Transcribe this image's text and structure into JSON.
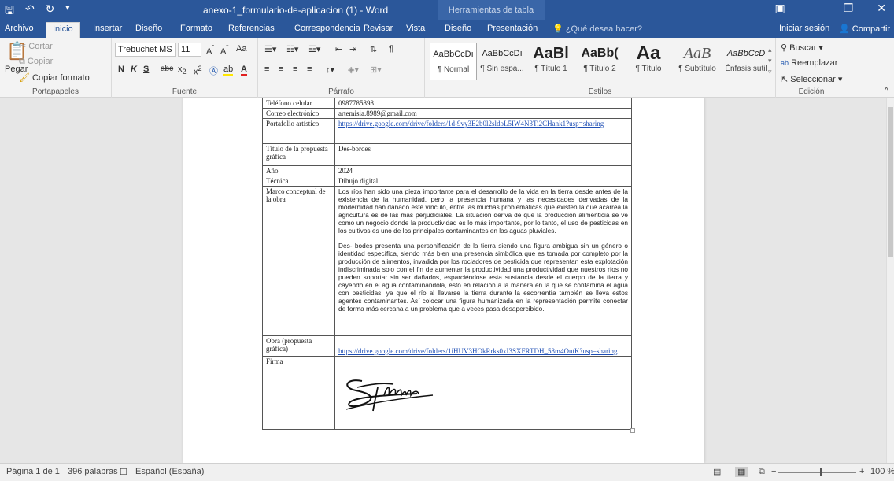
{
  "titlebar": {
    "save_icon": "save-icon",
    "undo_icon": "undo-icon",
    "redo_icon": "redo-icon",
    "customize_icon": "customize-icon",
    "doc_title": "anexo-1_formulario-de-aplicacion (1) - Word",
    "context_tab": "Herramientas de tabla"
  },
  "tabs": [
    "Archivo",
    "Inicio",
    "Insertar",
    "Diseño",
    "Formato",
    "Referencias",
    "Correspondencia",
    "Revisar",
    "Vista",
    "Diseño",
    "Presentación"
  ],
  "tellme": "¿Qué desea hacer?",
  "signin": "Iniciar sesión",
  "share": "Compartir",
  "ribbon": {
    "clipboard": {
      "paste": "Pegar",
      "cut": "Cortar",
      "copy": "Copiar",
      "format_painter": "Copiar formato",
      "label": "Portapapeles"
    },
    "font": {
      "name": "Trebuchet MS",
      "size": "11",
      "label": "Fuente",
      "aa": "Aa"
    },
    "paragraph": {
      "label": "Párrafo"
    },
    "styles": {
      "label": "Estilos",
      "items": [
        {
          "sample": "AaBbCcDı",
          "name": "¶ Normal"
        },
        {
          "sample": "AaBbCcDı",
          "name": "¶ Sin espa..."
        },
        {
          "sample": "AaBl",
          "name": "¶ Título 1"
        },
        {
          "sample": "AaBb(",
          "name": "¶ Título 2"
        },
        {
          "sample": "Aa",
          "name": "¶ Título"
        },
        {
          "sample": "AaB",
          "name": "¶ Subtítulo"
        },
        {
          "sample": "AaBbCcD",
          "name": "Énfasis sutil"
        }
      ]
    },
    "editing": {
      "find": "Buscar",
      "replace": "Reemplazar",
      "select": "Seleccionar",
      "label": "Edición"
    }
  },
  "form": {
    "rows": [
      {
        "label": "Teléfono celular",
        "value": "0987785898"
      },
      {
        "label": "Correo electrónico",
        "value": "artemisia.8989@gmail.com"
      },
      {
        "label": "Portafolio artístico",
        "link": "https://drive.google.com/drive/folders/1d-9vy3E2b0l2sldoL5IW4N3Ti2CHank1?usp=sharing"
      },
      {
        "label": "Título de la propuesta gráfica",
        "value": "Des-bordes"
      },
      {
        "label": "Año",
        "value": "2024"
      },
      {
        "label": "Técnica",
        "value": "Dibujo digital"
      }
    ],
    "marco_label": "Marco conceptual de la obra",
    "marco_p1": "Los ríos han sido una pieza importante para el desarrollo de la vida en la tierra desde antes de la existencia de la humanidad, pero la presencia humana y las necesidades derivadas de la modernidad han dañado este vínculo, entre las muchas problemáticas que existen la que acarrea la agricultura es de las más perjudiciales. La situación deriva de que la producción alimenticia se ve como un negocio donde la productividad es lo más importante, por lo tanto, el uso de pesticidas en los cultivos es uno de los principales contaminantes en las aguas pluviales.",
    "marco_p2": "Des- bodes presenta una personificación de la tierra siendo una figura ambigua sin un género o identidad específica, siendo más bien una presencia simbólica que es tomada por completo por la producción de alimentos, invadida por los rociadores de pesticida que representan esta explotación indiscriminada solo con el fin de aumentar la productividad una productividad que nuestros ríos no pueden soportar sin ser dañados, esparciéndose esta sustancia desde el cuerpo de la tierra y cayendo en el agua contaminándola, esto en relación a la manera en la que se contamina el agua con pesticidas, ya que el río al llevarse la tierra durante la escorrentía también se lleva estos agentes contaminantes. Así colocar una figura humanizada en la representación permite conectar de forma más cercana a un problema que a veces pasa desapercibido.",
    "obra_label": "Obra (propuesta gráfica)",
    "obra_link": "https://drive.google.com/drive/folders/1iHUV3HOkRrks0xI3SXFRTDH_58m4OutK?usp=sharing",
    "firma_label": "Firma"
  },
  "status": {
    "page": "Página 1 de 1",
    "words": "396 palabras",
    "language": "Español (España)",
    "zoom": "100 %",
    "zoom_percent": 100
  }
}
